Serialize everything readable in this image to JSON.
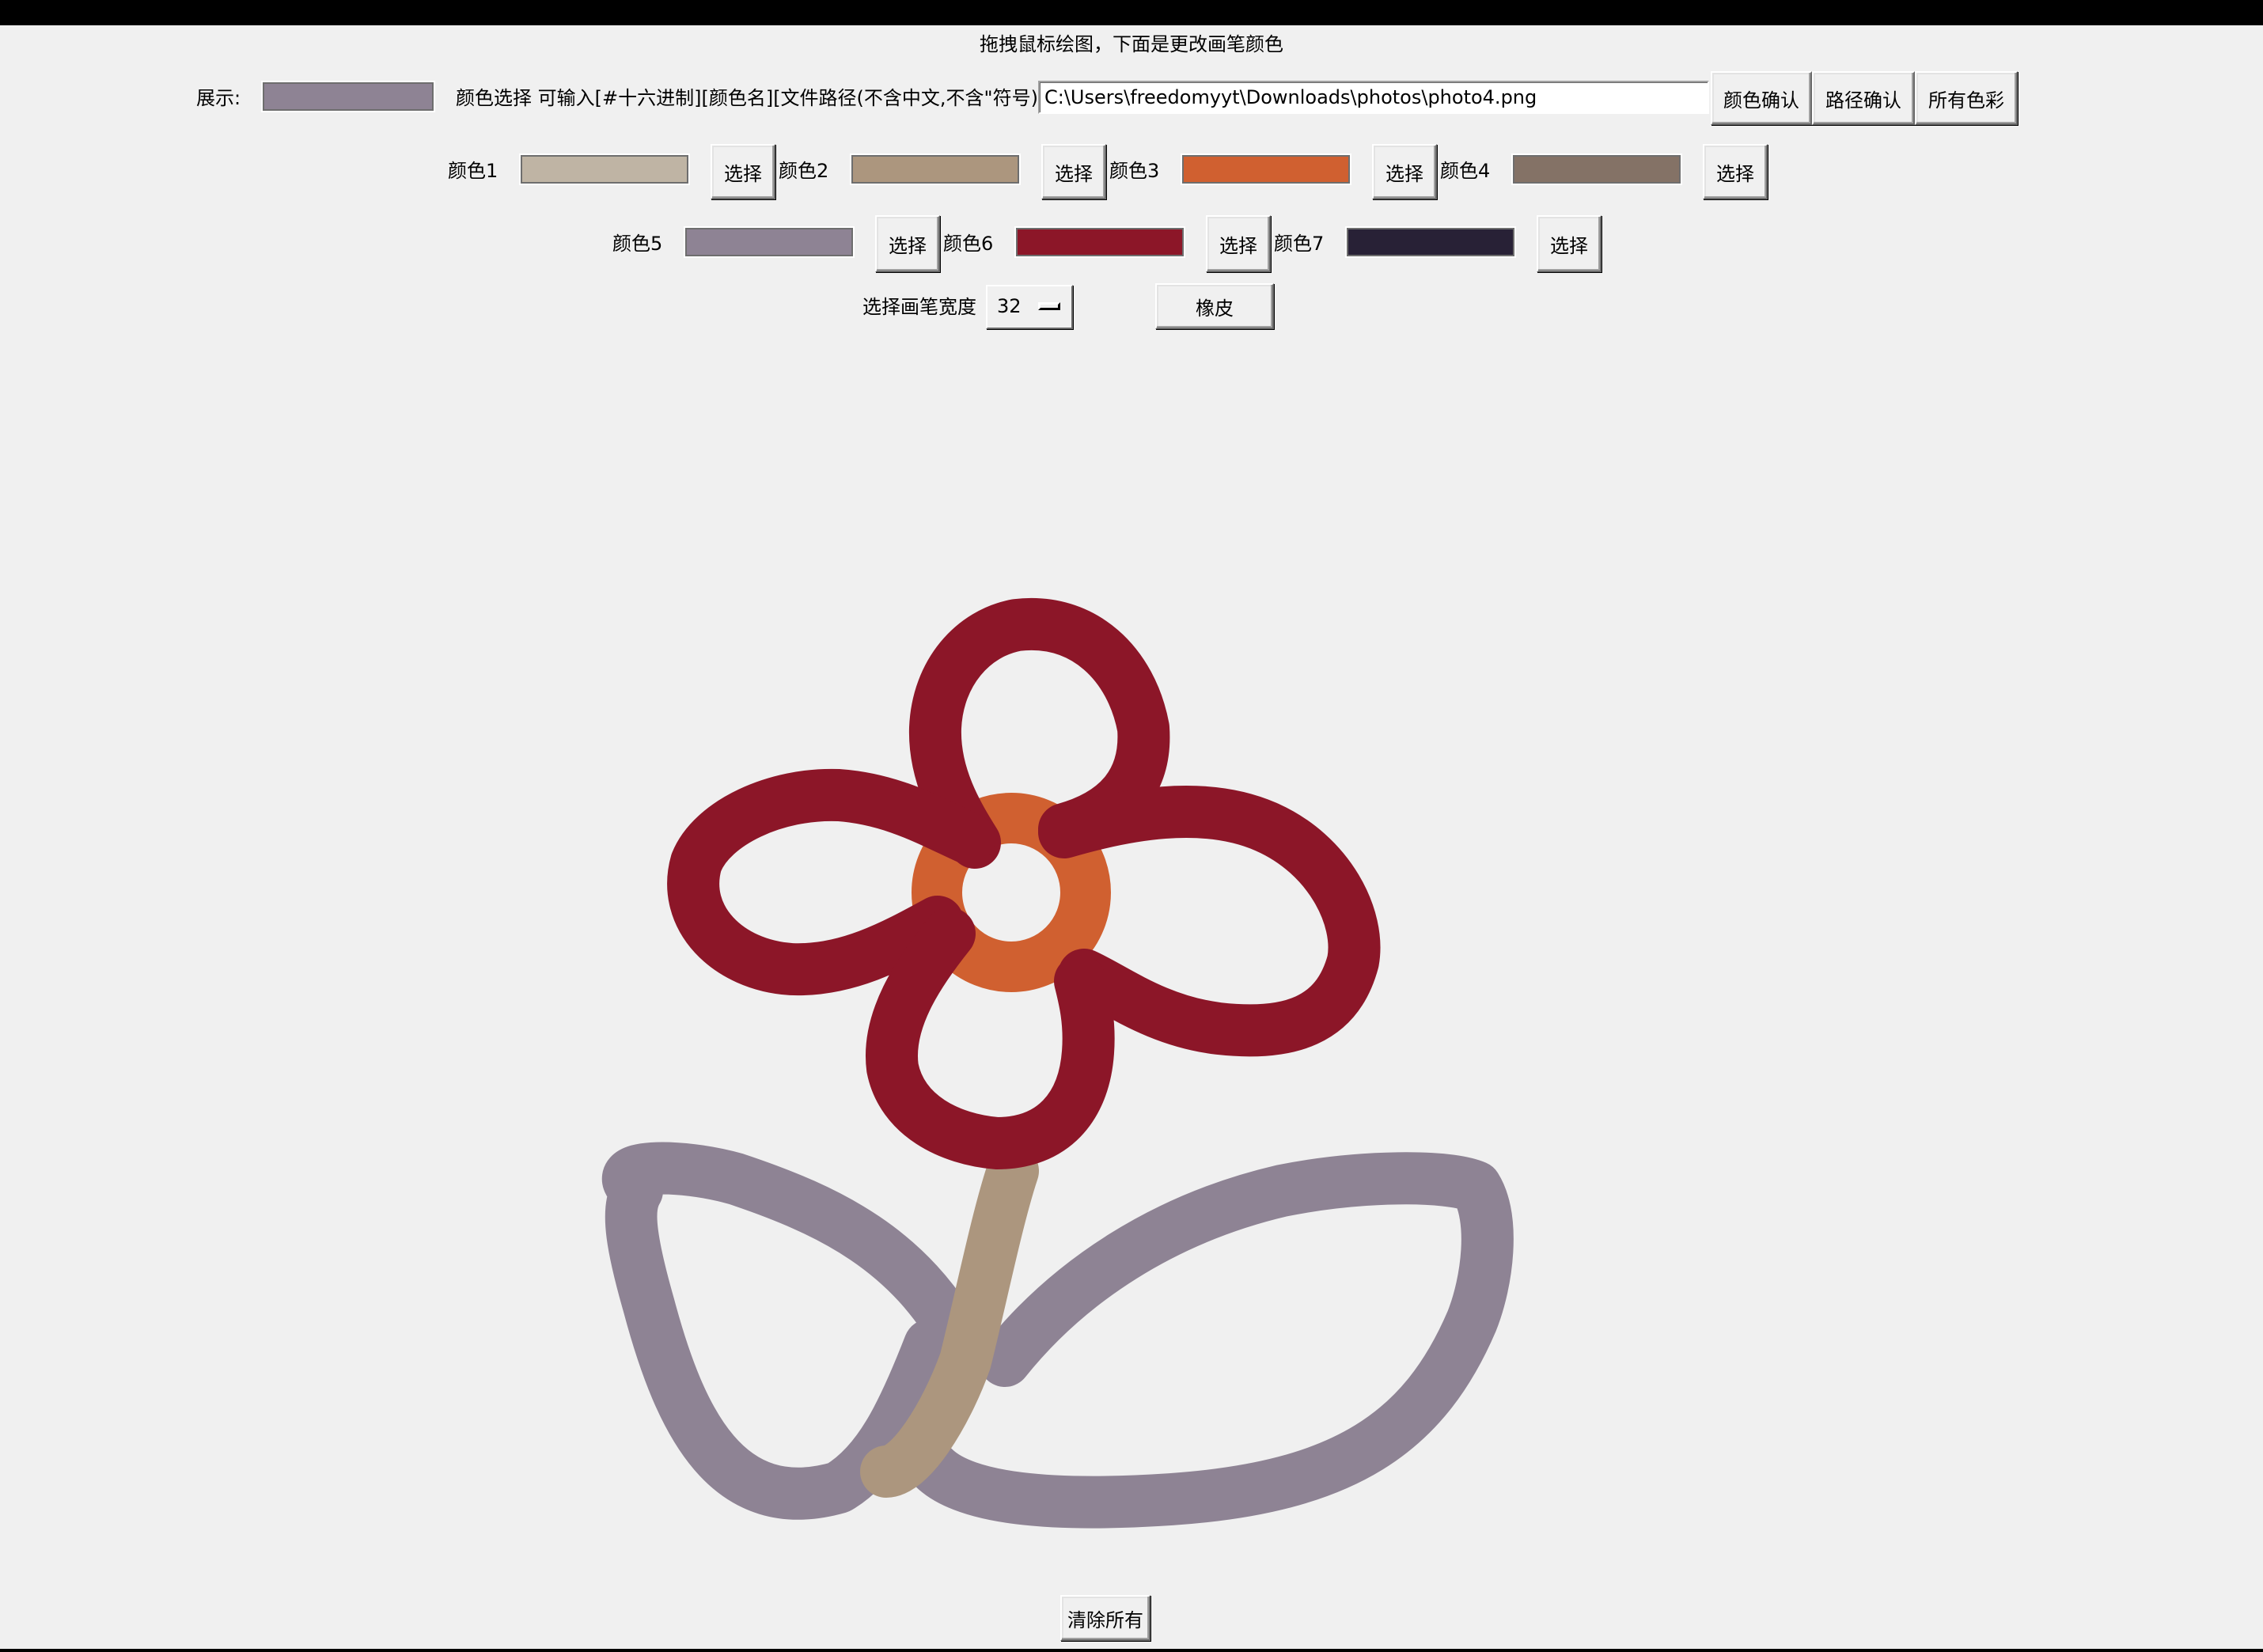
{
  "header": {
    "instruction": "拖拽鼠标绘图，下面是更改画笔颜色"
  },
  "toolbar": {
    "display_label": "展示:",
    "display_color": "#8e8394",
    "color_select_label": "颜色选择 可输入[#十六进制][颜色名][文件路径(不含中文,不含\"符号)]",
    "path_value": "C:\\Users\\freedomyyt\\Downloads\\photos\\photo4.png",
    "confirm_color_label": "颜色确认",
    "confirm_path_label": "路径确认",
    "all_colors_label": "所有色彩"
  },
  "palette": {
    "select_label": "选择",
    "colors": [
      {
        "label": "颜色1",
        "hex": "#bfb4a4"
      },
      {
        "label": "颜色2",
        "hex": "#ac967e"
      },
      {
        "label": "颜色3",
        "hex": "#d06030"
      },
      {
        "label": "颜色4",
        "hex": "#847266"
      },
      {
        "label": "颜色5",
        "hex": "#8e8394"
      },
      {
        "label": "颜色6",
        "hex": "#8c1628"
      },
      {
        "label": "颜色7",
        "hex": "#282136"
      }
    ]
  },
  "brush": {
    "width_label": "选择画笔宽度",
    "width_value": "32",
    "eraser_label": "橡皮"
  },
  "footer": {
    "clear_label": "清除所有"
  },
  "drawing": {
    "background": "#f0f0f0",
    "petal_color": "#8c1628",
    "center_color": "#d06030",
    "stem_color": "#ac967e",
    "leaf_color": "#8e8394"
  }
}
